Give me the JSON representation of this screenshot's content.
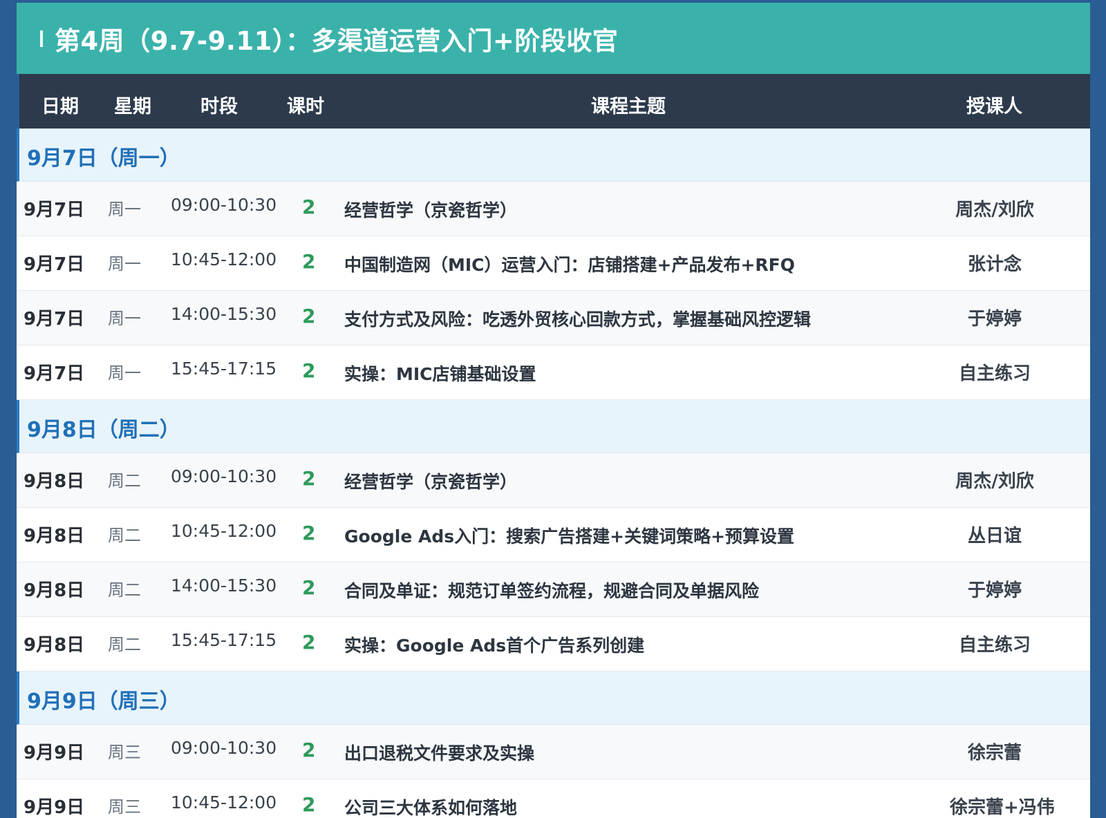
{
  "title": "第4周（9.7-9.11）：多渠道运营入门+阶段收官",
  "columns": {
    "date": "日期",
    "weekday": "星期",
    "time": "时段",
    "hours": "课时",
    "topic": "课程主题",
    "teacher": "授课人"
  },
  "groups": [
    {
      "label": "9月7日（周一）",
      "rows": [
        {
          "date": "9月7日",
          "weekday": "周一",
          "time": "09:00-10:30",
          "hours": "2",
          "topic": "经营哲学（京瓷哲学）",
          "teacher": "周杰/刘欣"
        },
        {
          "date": "9月7日",
          "weekday": "周一",
          "time": "10:45-12:00",
          "hours": "2",
          "topic": "中国制造网（MIC）运营入门：店铺搭建+产品发布+RFQ",
          "teacher": "张计念"
        },
        {
          "date": "9月7日",
          "weekday": "周一",
          "time": "14:00-15:30",
          "hours": "2",
          "topic": "支付方式及风险：吃透外贸核心回款方式，掌握基础风控逻辑",
          "teacher": "于婷婷"
        },
        {
          "date": "9月7日",
          "weekday": "周一",
          "time": "15:45-17:15",
          "hours": "2",
          "topic": "实操：MIC店铺基础设置",
          "teacher": "自主练习"
        }
      ]
    },
    {
      "label": "9月8日（周二）",
      "rows": [
        {
          "date": "9月8日",
          "weekday": "周二",
          "time": "09:00-10:30",
          "hours": "2",
          "topic": "经营哲学（京瓷哲学）",
          "teacher": "周杰/刘欣"
        },
        {
          "date": "9月8日",
          "weekday": "周二",
          "time": "10:45-12:00",
          "hours": "2",
          "topic": "Google Ads入门：搜索广告搭建+关键词策略+预算设置",
          "teacher": "丛日谊"
        },
        {
          "date": "9月8日",
          "weekday": "周二",
          "time": "14:00-15:30",
          "hours": "2",
          "topic": "合同及单证：规范订单签约流程，规避合同及单据风险",
          "teacher": "于婷婷"
        },
        {
          "date": "9月8日",
          "weekday": "周二",
          "time": "15:45-17:15",
          "hours": "2",
          "topic": "实操：Google Ads首个广告系列创建",
          "teacher": "自主练习"
        }
      ]
    },
    {
      "label": "9月9日（周三）",
      "rows": [
        {
          "date": "9月9日",
          "weekday": "周三",
          "time": "09:00-10:30",
          "hours": "2",
          "topic": "出口退税文件要求及实操",
          "teacher": "徐宗蕾"
        },
        {
          "date": "9月9日",
          "weekday": "周三",
          "time": "10:45-12:00",
          "hours": "2",
          "topic": "公司三大体系如何落地",
          "teacher": "徐宗蕾+冯伟"
        }
      ]
    }
  ]
}
